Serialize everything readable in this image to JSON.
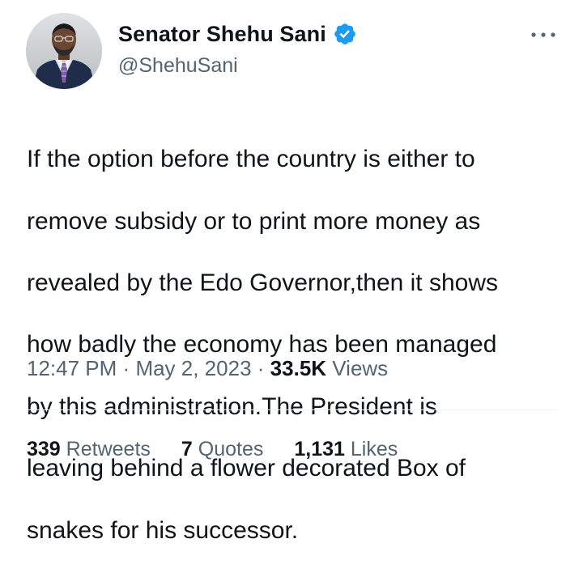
{
  "author": {
    "display_name": "Senator Shehu Sani",
    "handle": "@ShehuSani",
    "verified_badge_color": "#1d9bf0"
  },
  "tweet": {
    "text_lines": [
      "If the option before the country is either to",
      "remove subsidy or to print more money as",
      "revealed by the Edo Governor,then it shows",
      "how badly the economy has been managed",
      "by this administration.The President is",
      "leaving behind a flower decorated Box of",
      "snakes for his successor."
    ]
  },
  "meta": {
    "time": "12:47 PM",
    "separator": "·",
    "date": "May 2, 2023",
    "views_count": "33.5K",
    "views_label": "Views"
  },
  "stats": {
    "retweets_count": "339",
    "retweets_label": "Retweets",
    "quotes_count": "7",
    "quotes_label": "Quotes",
    "likes_count": "1,131",
    "likes_label": "Likes"
  },
  "icons": {
    "more": "more-horizontal-icon",
    "verified": "verified-badge-icon"
  },
  "colors": {
    "text_primary": "#0f1419",
    "text_secondary": "#536471",
    "divider": "#eff3f4"
  }
}
